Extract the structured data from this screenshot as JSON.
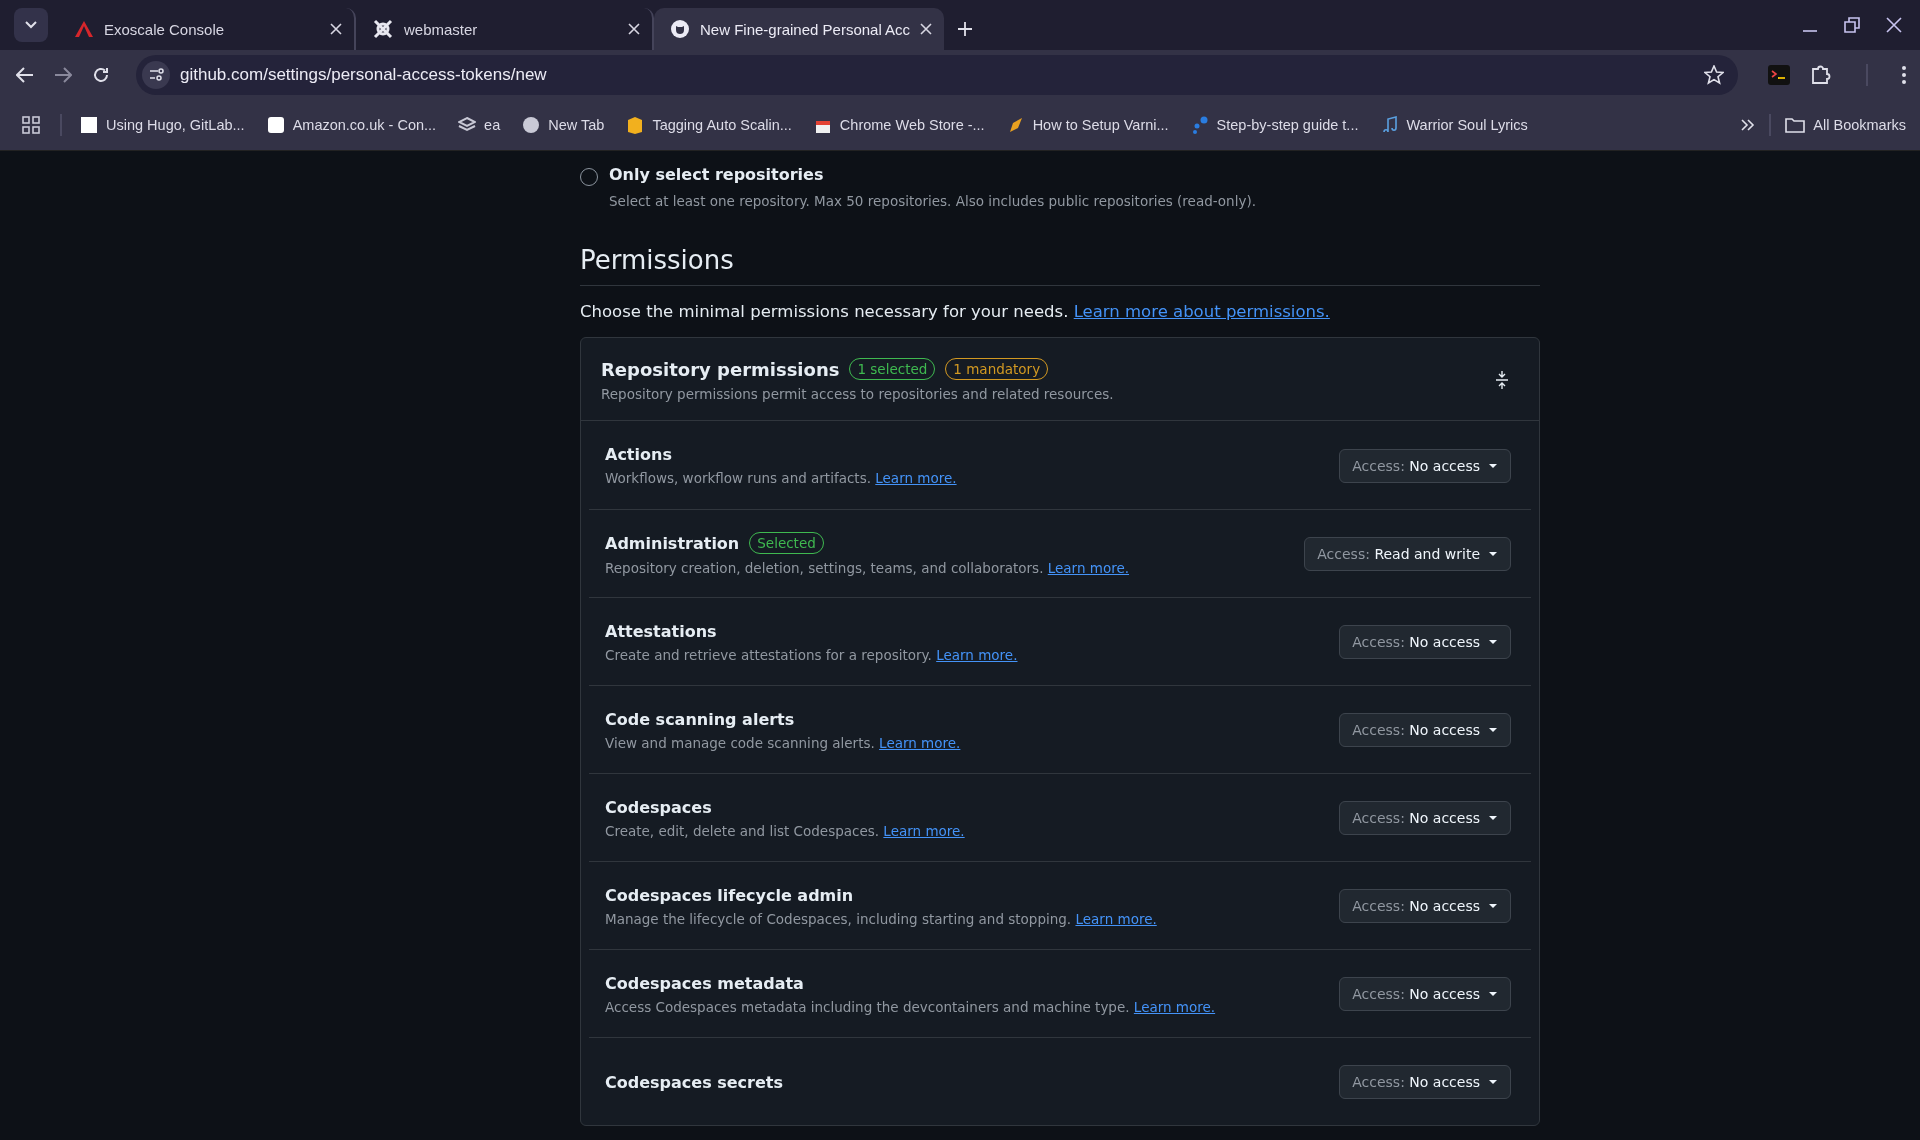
{
  "browser": {
    "tabs": [
      {
        "title": "Exoscale Console",
        "selected": false
      },
      {
        "title": "webmaster",
        "selected": false
      },
      {
        "title": "New Fine-grained Personal Acc",
        "selected": true
      }
    ],
    "address": "github.com/settings/personal-access-tokens/new",
    "bookmarks": [
      "Using Hugo, GitLab...",
      "Amazon.co.uk - Con...",
      "ea",
      "New Tab",
      "Tagging Auto Scalin...",
      "Chrome Web Store -...",
      "How to Setup Varni...",
      "Step-by-step guide t...",
      "Warrior Soul Lyrics"
    ],
    "all_bookmarks": "All Bookmarks"
  },
  "repository_access": {
    "option": {
      "label": "Only select repositories",
      "description": "Select at least one repository. Max 50 repositories. Also includes public repositories (read-only).",
      "selected": false
    }
  },
  "permissions": {
    "heading": "Permissions",
    "intro": "Choose the minimal permissions necessary for your needs.",
    "intro_link": "Learn more about permissions.",
    "group": {
      "title": "Repository permissions",
      "badges": [
        {
          "text": "1 selected",
          "color": "#3fb950"
        },
        {
          "text": "1 mandatory",
          "color": "#d29922"
        }
      ],
      "description": "Repository permissions permit access to repositories and related resources.",
      "rows": [
        {
          "name": "Actions",
          "description": "Workflows, workflow runs and artifacts.",
          "link": "Learn more.",
          "access_label": "Access:",
          "access": "No access"
        },
        {
          "name": "Administration",
          "badge": "Selected",
          "description": "Repository creation, deletion, settings, teams, and collaborators.",
          "link": "Learn more.",
          "access_label": "Access:",
          "access": "Read and write"
        },
        {
          "name": "Attestations",
          "description": "Create and retrieve attestations for a repository.",
          "link": "Learn more.",
          "access_label": "Access:",
          "access": "No access"
        },
        {
          "name": "Code scanning alerts",
          "description": "View and manage code scanning alerts.",
          "link": "Learn more.",
          "access_label": "Access:",
          "access": "No access"
        },
        {
          "name": "Codespaces",
          "description": "Create, edit, delete and list Codespaces.",
          "link": "Learn more.",
          "access_label": "Access:",
          "access": "No access"
        },
        {
          "name": "Codespaces lifecycle admin",
          "description": "Manage the lifecycle of Codespaces, including starting and stopping.",
          "link": "Learn more.",
          "access_label": "Access:",
          "access": "No access"
        },
        {
          "name": "Codespaces metadata",
          "description": "Access Codespaces metadata including the devcontainers and machine type.",
          "link": "Learn more.",
          "access_label": "Access:",
          "access": "No access"
        },
        {
          "name": "Codespaces secrets",
          "access_label": "Access:",
          "access": "No access"
        }
      ]
    }
  }
}
